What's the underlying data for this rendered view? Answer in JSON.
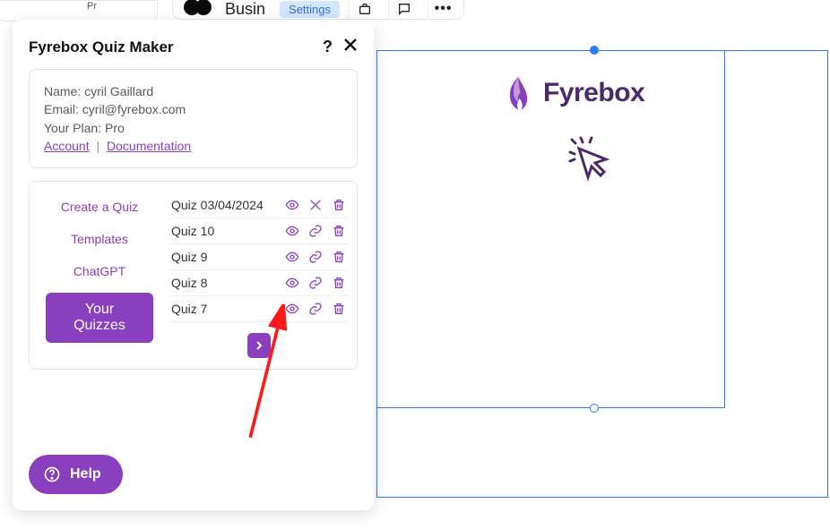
{
  "toolbar": {
    "left_tag": "Pr",
    "business_label": "Busin",
    "settings_chip": "Settings",
    "more": "•••"
  },
  "popup": {
    "title": "Fyrebox Quiz Maker",
    "help": "?"
  },
  "account": {
    "name_label": "Name:",
    "name_value": "cyril Gaillard",
    "email_label": "Email:",
    "email_value": "cyril@fyrebox.com",
    "plan_label": "Your Plan:",
    "plan_value": "Pro",
    "account_link": "Account",
    "docs_link": "Documentation"
  },
  "nav": {
    "create": "Create a Quiz",
    "templates": "Templates",
    "chatgpt": "ChatGPT",
    "your_quizzes": "Your Quizzes"
  },
  "quizzes": [
    {
      "name": "Quiz 03/04/2024",
      "icon2": "unlink"
    },
    {
      "name": "Quiz 10",
      "icon2": "link"
    },
    {
      "name": "Quiz 9",
      "icon2": "link"
    },
    {
      "name": "Quiz 8",
      "icon2": "link"
    },
    {
      "name": "Quiz 7",
      "icon2": "link"
    }
  ],
  "help_pill": "Help",
  "brand": "Fyrebox"
}
